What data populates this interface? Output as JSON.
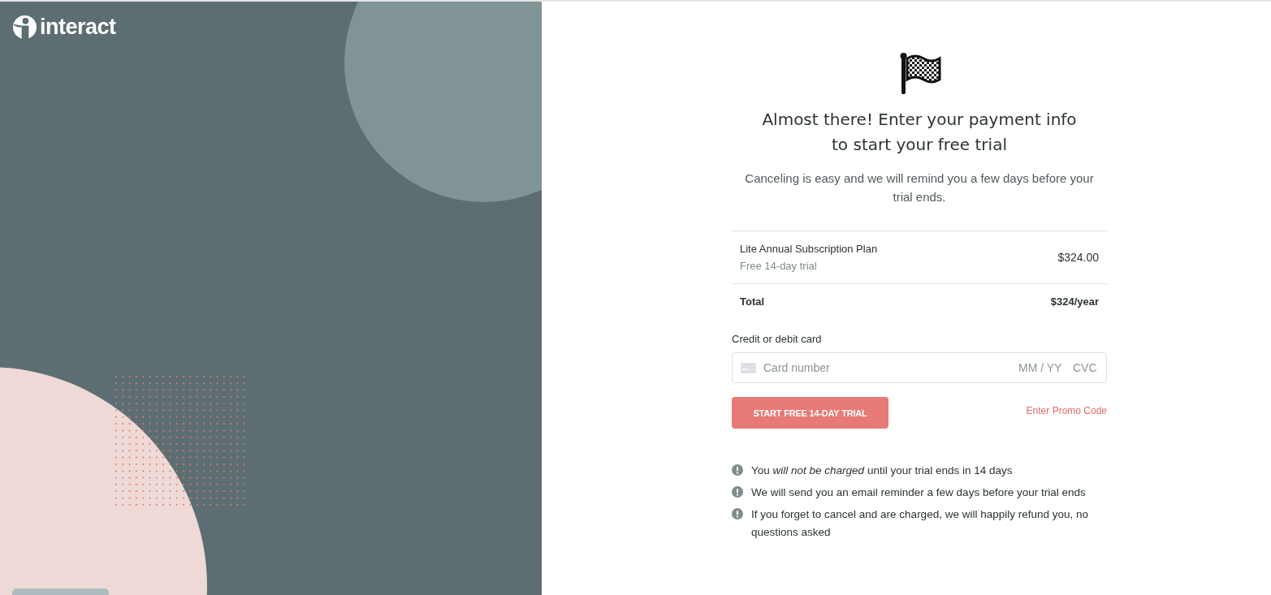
{
  "brand": {
    "name": "interact"
  },
  "heading": "Almost there! Enter your payment info to start your free trial",
  "subheading": "Canceling is easy and we will remind you a few days before your trial ends.",
  "order": {
    "items": [
      {
        "name": "Lite Annual Subscription Plan",
        "note": "Free 14-day trial",
        "price": "$324.00"
      }
    ],
    "total": {
      "label": "Total",
      "amount": "$324/year"
    }
  },
  "card": {
    "label": "Credit or debit card",
    "placeholder": "Card number",
    "expiry_placeholder": "MM / YY",
    "cvc_placeholder": "CVC"
  },
  "submit_button": "START FREE 14-DAY TRIAL",
  "promo_link": "Enter Promo Code",
  "notes": [
    "You *will not be charged* until your trial ends in 14 days",
    "We will send you an email reminder a few days before your trial ends",
    "If you forget to cancel and are charged, we will happily refund you, no questions asked"
  ]
}
